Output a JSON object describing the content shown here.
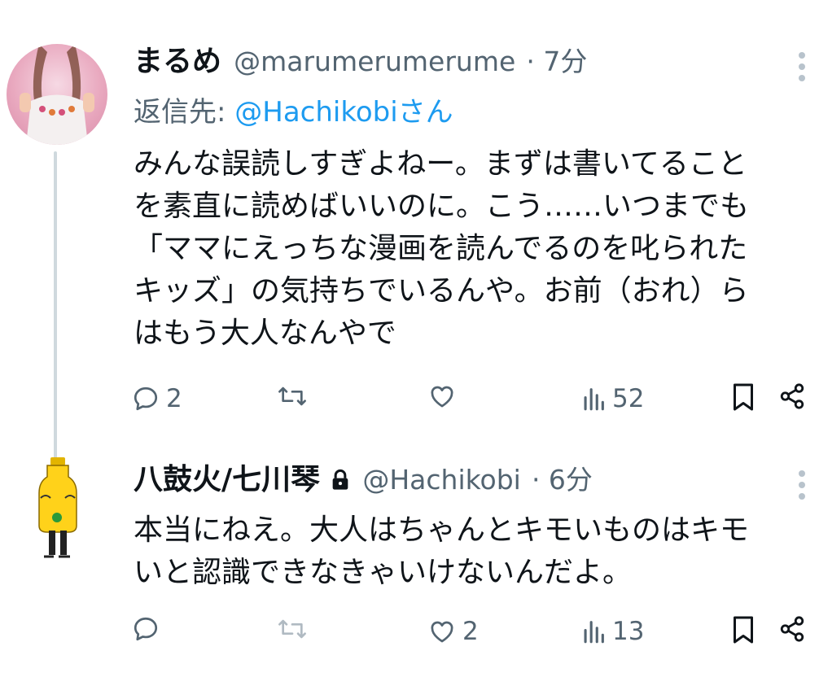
{
  "tweet1": {
    "display_name": "まるめ",
    "handle": "@marumerumerume",
    "time": "· 7分",
    "reply_prefix": "返信先:",
    "reply_to": "@Hachikobi",
    "reply_suffix": "さん",
    "lines": [
      "みんな誤読しすぎよねー。まずは書いてること",
      "を素直に読めばいいのに。こう……いつまでも",
      "「ママにえっちな漫画を読んでるのを叱られた",
      "キッズ」の気持ちでいるんや。お前（おれ）ら",
      "はもう大人なんやで"
    ],
    "actions": {
      "reply_count": "2",
      "retweet_count": "",
      "like_count": "",
      "view_count": "52"
    }
  },
  "tweet2": {
    "display_name": "八鼓火/七川琴",
    "handle": "@Hachikobi",
    "time": "· 6分",
    "lines": [
      "本当にねえ。大人はちゃんとキモいものはキモ",
      "いと認識できなきゃいけないんだよ。"
    ],
    "actions": {
      "reply_count": "",
      "retweet_count": "",
      "like_count": "2",
      "view_count": "13"
    }
  },
  "icons": [
    "reply-icon",
    "retweet-icon",
    "like-icon",
    "views-icon",
    "bookmark-icon",
    "share-icon",
    "lock-icon",
    "more-icon"
  ],
  "colors": {
    "text": "#0f1419",
    "secondary": "#536471",
    "link": "#1d9bf0",
    "thread_line": "#cfd9de"
  }
}
